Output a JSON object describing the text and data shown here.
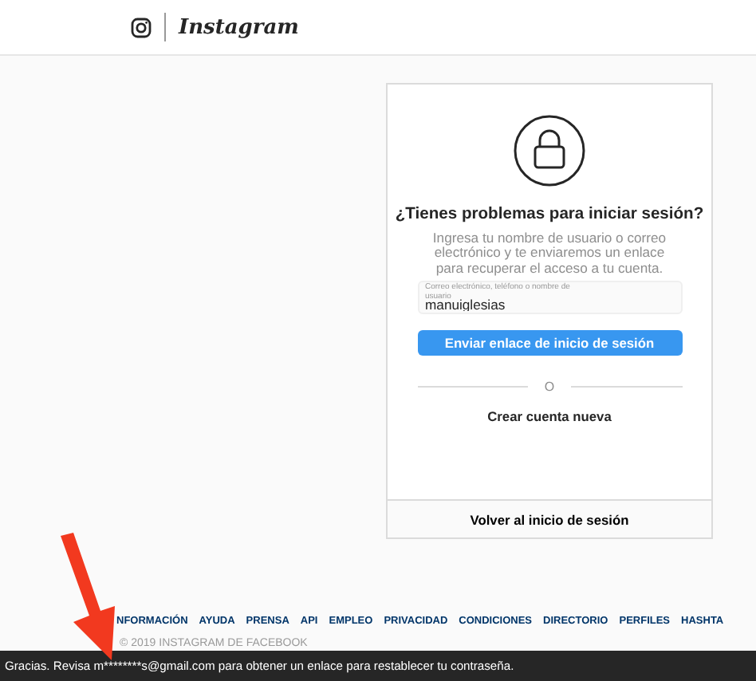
{
  "header": {
    "brand": "Instagram"
  },
  "card": {
    "title": "¿Tienes problemas para iniciar sesión?",
    "description": "Ingresa tu nombre de usuario o correo electrónico y te enviaremos un enlace para recuperar el acceso a tu cuenta.",
    "field": {
      "label": "Correo electrónico, teléfono o nombre de usuario",
      "value": "manuiglesias"
    },
    "submit_button": "Enviar enlace de inicio de sesión",
    "divider": "O",
    "create_link": "Crear cuenta nueva",
    "back_link": "Volver al inicio de sesión"
  },
  "footer": {
    "links": [
      "NFORMACIÓN",
      "AYUDA",
      "PRENSA",
      "API",
      "EMPLEO",
      "PRIVACIDAD",
      "CONDICIONES",
      "DIRECTORIO",
      "PERFILES",
      "HASHTA"
    ],
    "copyright": "© 2019 INSTAGRAM DE FACEBOOK"
  },
  "toast": {
    "message": "Gracias. Revisa m********s@gmail.com para obtener un enlace para restablecer tu contraseña."
  }
}
